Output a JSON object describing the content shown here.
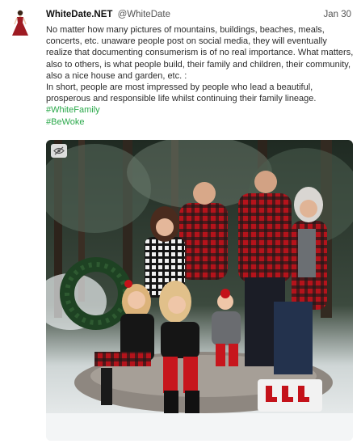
{
  "post": {
    "author_name": "WhiteDate.NET",
    "author_handle": "@WhiteDate",
    "date": "Jan 30",
    "body": "No matter how many pictures of mountains, buildings, beaches, meals, concerts, etc. unaware people post on social media, they will eventually realize that documenting consumerism is of no real importance. What matters, also to others, is what people build, their family and children, their community, also a nice house and garden, etc. :",
    "body2": "In short, people are most impressed by people who lead a beautiful, prosperous and responsible life whilst continuing their family lineage.",
    "hashtags": [
      "#WhiteFamily",
      "#BeWoke"
    ]
  },
  "icons": {
    "avatar": "woman-in-red-dress-icon",
    "media_toggle": "eye-slash-icon"
  },
  "colors": {
    "hashtag": "#2aa84a",
    "text": "#2b2b2b",
    "meta": "#555555"
  }
}
